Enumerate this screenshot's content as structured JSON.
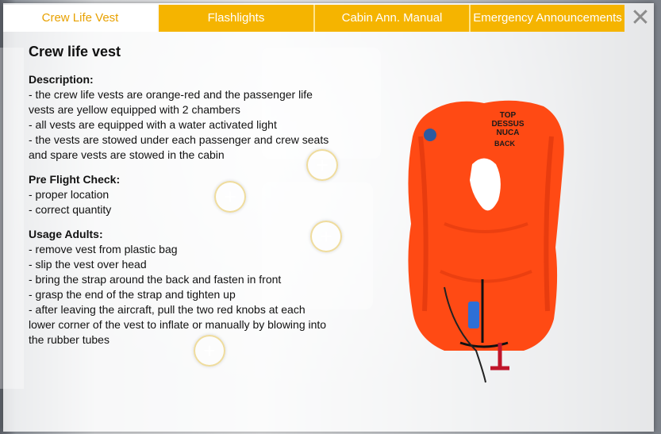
{
  "tabs": [
    {
      "label": "Crew Life Vest",
      "active": true
    },
    {
      "label": "Flashlights",
      "active": false
    },
    {
      "label": "Cabin Ann. Manual",
      "active": false
    },
    {
      "label": "Emergency Announcements",
      "active": false
    }
  ],
  "close_icon": "close-x-icon",
  "title": "Crew life vest",
  "sections": [
    {
      "heading": "Description:",
      "lines": [
        "- the crew life vests are orange-red and the passenger life vests are yellow equipped with 2 chambers",
        "- all vests are equipped with a water activated light",
        "- the vests are stowed under each passenger and crew seats and spare vests are stowed in the cabin"
      ]
    },
    {
      "heading": "Pre Flight Check:",
      "lines": [
        "- proper location",
        "- correct quantity"
      ]
    },
    {
      "heading": "Usage Adults:",
      "lines": [
        "- remove vest from plastic bag",
        "- slip the vest over head",
        "- bring the strap around the back and fasten in front",
        "- grasp the end of the strap and tighten up",
        "- after leaving the aircraft, pull the two red knobs at each lower corner of the vest to inflate or manually by blowing into the rubber tubes"
      ]
    }
  ],
  "vest_image": {
    "label_lines": [
      "TOP",
      "DESSUS",
      "NUCA",
      "BACK"
    ],
    "colors": {
      "vest": "#ff4a14",
      "vest_shadow": "#d8340c"
    }
  },
  "hotspots": [
    {
      "label": "+"
    },
    {
      "label": "+"
    },
    {
      "label": "+"
    },
    {
      "label": "+"
    }
  ],
  "colors": {
    "tab": "#f5b400",
    "tab_active_text": "#e8a100"
  }
}
